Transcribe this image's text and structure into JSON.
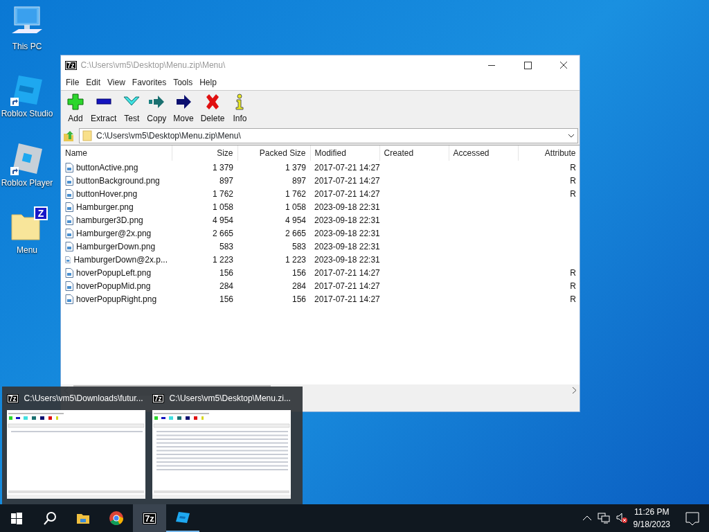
{
  "desktop_icons": [
    {
      "kind": "pc",
      "label": "This PC"
    },
    {
      "kind": "studio",
      "label": "Roblox Studio",
      "shortcut": true
    },
    {
      "kind": "player",
      "label": "Roblox Player",
      "shortcut": true
    },
    {
      "kind": "zipfolder",
      "label": "Menu",
      "badge": "Z"
    }
  ],
  "window": {
    "logo": "7z",
    "title": "C:\\Users\\vm5\\Desktop\\Menu.zip\\Menu\\",
    "menu": [
      "File",
      "Edit",
      "View",
      "Favorites",
      "Tools",
      "Help"
    ],
    "toolbar": [
      {
        "kind": "add",
        "label": "Add"
      },
      {
        "kind": "extract",
        "label": "Extract"
      },
      {
        "kind": "test",
        "label": "Test"
      },
      {
        "kind": "copy",
        "label": "Copy"
      },
      {
        "kind": "move",
        "label": "Move"
      },
      {
        "kind": "delete",
        "label": "Delete"
      },
      {
        "kind": "info",
        "label": "Info"
      }
    ],
    "address": "C:\\Users\\vm5\\Desktop\\Menu.zip\\Menu\\",
    "table": {
      "columns": [
        "Name",
        "Size",
        "Packed Size",
        "Modified",
        "Created",
        "Accessed",
        "Attribute"
      ],
      "rows": [
        {
          "name": "buttonActive.png",
          "size": "1 379",
          "packed": "1 379",
          "modified": "2017-07-21 14:27",
          "attributes": "R"
        },
        {
          "name": "buttonBackground.png",
          "size": "897",
          "packed": "897",
          "modified": "2017-07-21 14:27",
          "attributes": "R"
        },
        {
          "name": "buttonHover.png",
          "size": "1 762",
          "packed": "1 762",
          "modified": "2017-07-21 14:27",
          "attributes": "R"
        },
        {
          "name": "Hamburger.png",
          "size": "1 058",
          "packed": "1 058",
          "modified": "2023-09-18 22:31"
        },
        {
          "name": "hamburger3D.png",
          "size": "4 954",
          "packed": "4 954",
          "modified": "2023-09-18 22:31"
        },
        {
          "name": "Hamburger@2x.png",
          "size": "2 665",
          "packed": "2 665",
          "modified": "2023-09-18 22:31"
        },
        {
          "name": "HamburgerDown.png",
          "size": "583",
          "packed": "583",
          "modified": "2023-09-18 22:31"
        },
        {
          "name": "HamburgerDown@2x.p...",
          "size": "1 223",
          "packed": "1 223",
          "modified": "2023-09-18 22:31"
        },
        {
          "name": "hoverPopupLeft.png",
          "size": "156",
          "packed": "156",
          "modified": "2017-07-21 14:27",
          "attributes": "R"
        },
        {
          "name": "hoverPopupMid.png",
          "size": "284",
          "packed": "284",
          "modified": "2017-07-21 14:27",
          "attributes": "R"
        },
        {
          "name": "hoverPopupRight.png",
          "size": "156",
          "packed": "156",
          "modified": "2017-07-21 14:27",
          "attributes": "R"
        }
      ]
    }
  },
  "thumbnails": [
    {
      "logo": "7z",
      "title": "C:\\Users\\vm5\\Downloads\\futur..."
    },
    {
      "logo": "7z",
      "title": "C:\\Users\\vm5\\Desktop\\Menu.zi..."
    }
  ],
  "taskbar": {
    "items": [
      {
        "kind": "start"
      },
      {
        "kind": "search"
      },
      {
        "kind": "explorer"
      },
      {
        "kind": "chrome"
      },
      {
        "kind": "sevenzip",
        "text": "7z",
        "selected": true
      },
      {
        "kind": "studio",
        "selected": false
      }
    ],
    "time": "11:26 PM",
    "date": "9/18/2023"
  }
}
